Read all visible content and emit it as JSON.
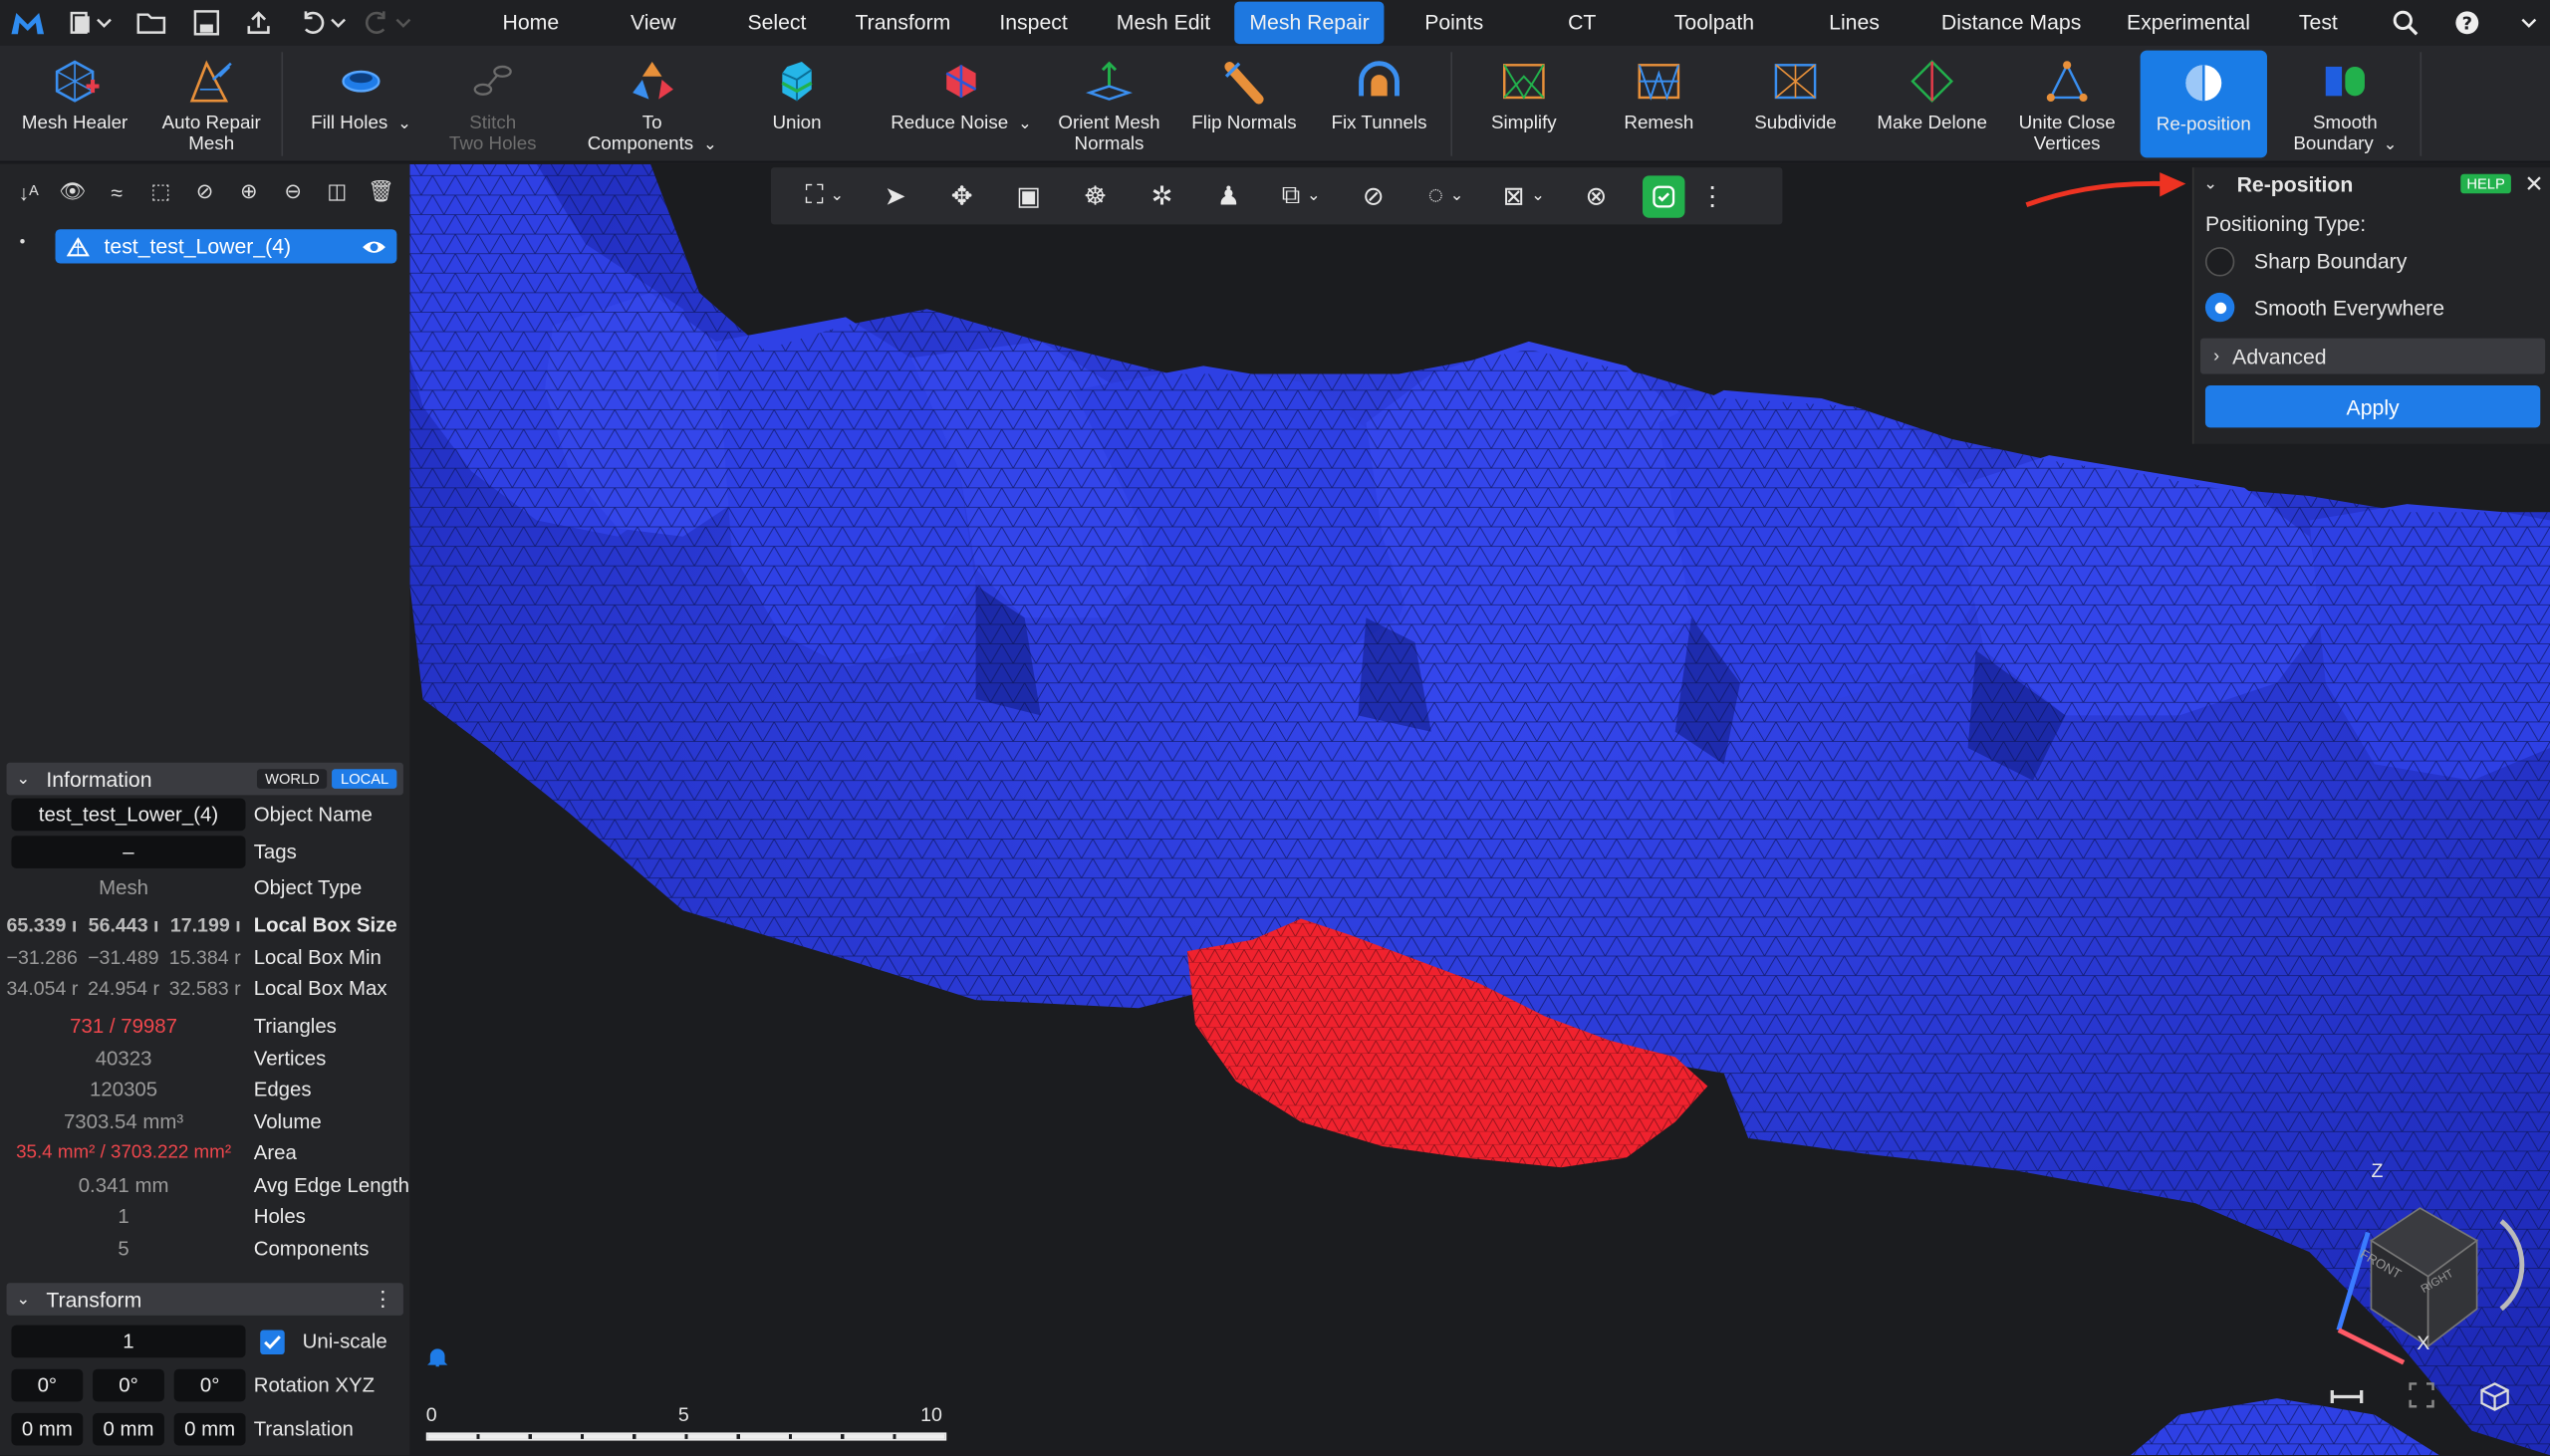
{
  "menu": {
    "items": [
      "Home",
      "View",
      "Select",
      "Transform",
      "Inspect",
      "Mesh Edit",
      "Mesh Repair",
      "Points",
      "CT",
      "Toolpath",
      "Lines",
      "Distance Maps",
      "Experimental",
      "Test"
    ],
    "active": "Mesh Repair"
  },
  "ribbon": {
    "mesh_healer": "Mesh Healer",
    "auto_repair_1": "Auto Repair",
    "auto_repair_2": "Mesh",
    "fill_holes": "Fill Holes",
    "stitch_1": "Stitch",
    "stitch_2": "Two Holes",
    "to_comp_1": "To",
    "to_comp_2": "Components",
    "union": "Union",
    "reduce_noise": "Reduce Noise",
    "orient_1": "Orient Mesh",
    "orient_2": "Normals",
    "flip_normals": "Flip Normals",
    "fix_tunnels": "Fix Tunnels",
    "simplify": "Simplify",
    "remesh": "Remesh",
    "subdivide": "Subdivide",
    "make_delone": "Make Delone",
    "unite_1": "Unite Close",
    "unite_2": "Vertices",
    "reposition": "Re-position",
    "smooth_b_1": "Smooth",
    "smooth_b_2": "Boundary"
  },
  "tree": {
    "object": "test_test_Lower_(4)"
  },
  "info": {
    "title": "Information",
    "world": "WORLD",
    "local": "LOCAL",
    "object_name_value": "test_test_Lower_(4)",
    "object_name_label": "Object Name",
    "tags_value": "–",
    "tags_label": "Tags",
    "object_type_value": "Mesh",
    "object_type_label": "Object Type",
    "box_size": [
      "65.339 ı",
      "56.443 ı",
      "17.199 ı"
    ],
    "box_size_label": "Local Box Size",
    "box_min": [
      "−31.286",
      "−31.489",
      "15.384 r"
    ],
    "box_min_label": "Local Box Min",
    "box_max": [
      "34.054 r",
      "24.954 r",
      "32.583 r"
    ],
    "box_max_label": "Local Box Max",
    "triangles_value": "731 / 79987",
    "triangles_label": "Triangles",
    "vertices_value": "40323",
    "vertices_label": "Vertices",
    "edges_value": "120305",
    "edges_label": "Edges",
    "volume_value": "7303.54 mm³",
    "volume_label": "Volume",
    "area_value": "35.4 mm² / 3703.222 mm²",
    "area_label": "Area",
    "avg_edge_value": "0.341 mm",
    "avg_edge_label": "Avg Edge Length",
    "holes_value": "1",
    "holes_label": "Holes",
    "components_value": "5",
    "components_label": "Components"
  },
  "transform": {
    "title": "Transform",
    "scale_value": "1",
    "uniscale_label": "Uni-scale",
    "rotation": [
      "0°",
      "0°",
      "0°"
    ],
    "rotation_label": "Rotation XYZ",
    "translation": [
      "0 mm",
      "0 mm",
      "0 mm"
    ],
    "translation_label": "Translation"
  },
  "scale_bar": {
    "labels": [
      "0",
      "5",
      "10"
    ]
  },
  "axes": {
    "z": "Z",
    "x": "X",
    "front": "FRONT",
    "right": "RIGHT"
  },
  "reposition_panel": {
    "title": "Re-position",
    "help": "HELP",
    "positioning_label": "Positioning Type:",
    "options": [
      "Sharp Boundary",
      "Smooth Everywhere"
    ],
    "selected": "Smooth Everywhere",
    "advanced": "Advanced",
    "apply": "Apply"
  },
  "colors": {
    "accent": "#1e78e0",
    "mesh": "#2c3de0",
    "selection": "#f0222e",
    "active_tool": "#22b14c"
  }
}
